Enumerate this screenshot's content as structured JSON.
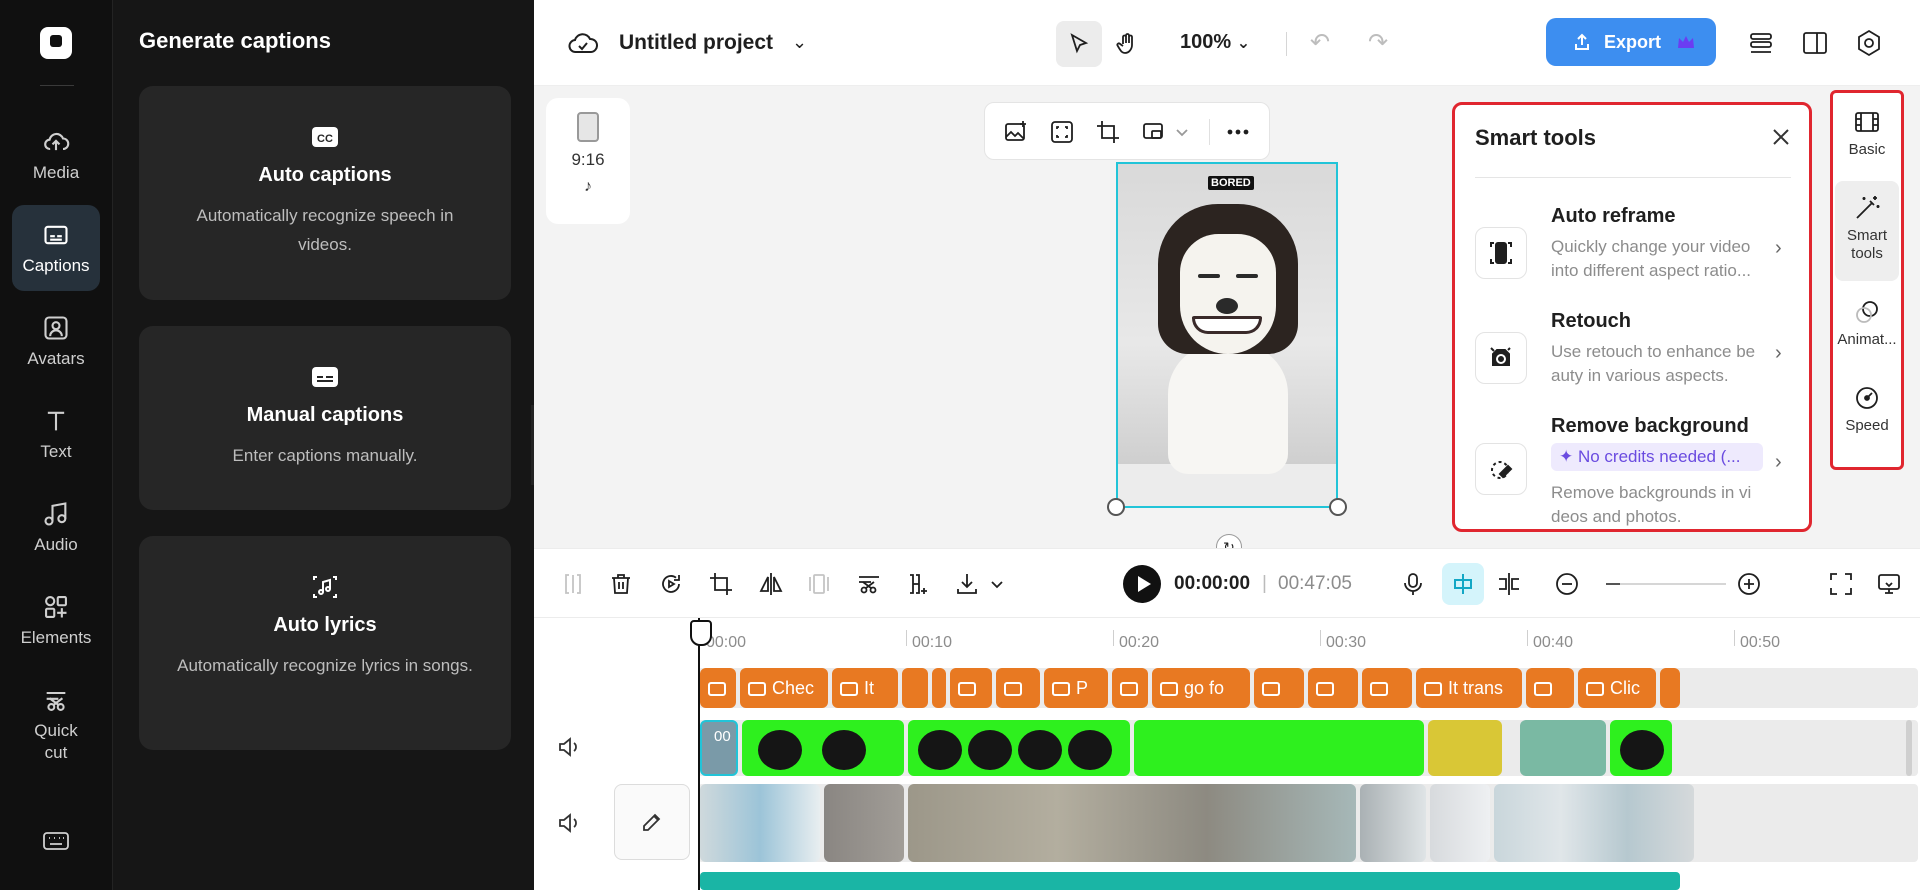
{
  "left_nav": {
    "items": [
      {
        "label": "Media",
        "icon": "cloud-upload-icon"
      },
      {
        "label": "Captions",
        "icon": "captions-icon",
        "active": true
      },
      {
        "label": "Avatars",
        "icon": "avatar-icon"
      },
      {
        "label": "Text",
        "icon": "text-icon"
      },
      {
        "label": "Audio",
        "icon": "music-note-icon"
      },
      {
        "label": "Elements",
        "icon": "elements-icon"
      },
      {
        "label": "Quick cut",
        "icon": "quick-cut-icon"
      }
    ]
  },
  "captions_panel": {
    "title": "Generate captions",
    "cards": [
      {
        "title": "Auto captions",
        "description": "Automatically recognize speech in videos.",
        "icon": "cc-icon"
      },
      {
        "title": "Manual captions",
        "description": "Enter captions manually.",
        "icon": "subtitle-icon"
      },
      {
        "title": "Auto lyrics",
        "description": "Automatically recognize lyrics in songs.",
        "icon": "music-file-icon"
      }
    ]
  },
  "topbar": {
    "project_title": "Untitled project",
    "zoom": "100%",
    "export_label": "Export"
  },
  "canvas": {
    "aspect_ratio": "9:16",
    "preview_tag": "BORED"
  },
  "smart_tools": {
    "title": "Smart tools",
    "items": [
      {
        "name": "Auto reframe",
        "description": "Quickly change your video into different aspect ratio..."
      },
      {
        "name": "Retouch",
        "description": "Use retouch to enhance be auty in various aspects."
      },
      {
        "name": "Remove background",
        "badge": "✦ No credits needed (...",
        "description": "Remove backgrounds in vi deos and photos."
      }
    ]
  },
  "right_rail": {
    "items": [
      {
        "label": "Basic"
      },
      {
        "label": "Smart tools",
        "active": true
      },
      {
        "label": "Animat..."
      },
      {
        "label": "Speed"
      }
    ]
  },
  "timeline_toolbar": {
    "current_time": "00:00:00",
    "separator": "|",
    "total_time": "00:47:05"
  },
  "timeline": {
    "ruler": [
      "00:00",
      "00:10",
      "00:20",
      "00:30",
      "00:40",
      "00:50"
    ],
    "caption_chips": [
      "",
      "Chec",
      "It",
      "",
      "",
      "",
      "P",
      "",
      "go fo",
      "",
      "",
      "",
      "It trans",
      "",
      "Clic"
    ],
    "first_clip_label": "00"
  },
  "colors": {
    "accent_blue": "#3d8ef0",
    "highlight_red": "#e0262f",
    "caption_orange": "#e87922",
    "greenscreen": "#2ef01e",
    "selection_cyan": "#21c4d8"
  }
}
